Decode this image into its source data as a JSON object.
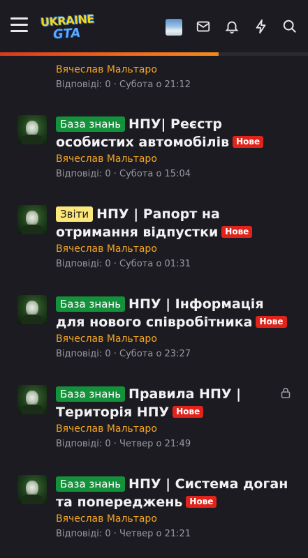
{
  "header": {
    "logo_top": "UKRAINE",
    "logo_bottom": "GTA",
    "icons": [
      "menu-icon",
      "user-avatar",
      "mail-icon",
      "bell-icon",
      "bolt-icon",
      "search-icon"
    ],
    "progress_fraction": 0.71,
    "accent_color": "#f26a1b"
  },
  "threads": [
    {
      "prefix": "",
      "prefix_color": "",
      "title": "",
      "badge": "",
      "author": "Вячеслав Мальтаро",
      "meta": "Відповіді: 0 · Субота о 21:12",
      "locked": false
    },
    {
      "prefix": "База знань",
      "prefix_color": "green",
      "title": "НПУ| Реєстр особистих автомобілів",
      "badge": "Нове",
      "author": "Вячеслав Мальтаро",
      "meta": "Відповіді: 0 · Субота о 15:04",
      "locked": false
    },
    {
      "prefix": "Звіти",
      "prefix_color": "yellow",
      "title": "НПУ | Рапорт на отримання відпустки",
      "badge": "Нове",
      "author": "Вячеслав Мальтаро",
      "meta": "Відповіді: 0 · Субота о 01:31",
      "locked": false
    },
    {
      "prefix": "База знань",
      "prefix_color": "green",
      "title": "НПУ | Інформація для нового співробітника",
      "badge": "Нове",
      "author": "Вячеслав Мальтаро",
      "meta": "Відповіді: 0 · Субота о 23:27",
      "locked": false
    },
    {
      "prefix": "База знань",
      "prefix_color": "green",
      "title": "Правила НПУ | Територія НПУ",
      "badge": "Нове",
      "author": "Вячеслав Мальтаро",
      "meta": "Відповіді: 0 · Четвер о 21:49",
      "locked": true
    },
    {
      "prefix": "База знань",
      "prefix_color": "green",
      "title": "НПУ | Система доган та попереджень",
      "badge": "Нове",
      "author": "Вячеслав Мальтаро",
      "meta": "Відповіді: 0 · Четвер о 21:21",
      "locked": false
    }
  ]
}
